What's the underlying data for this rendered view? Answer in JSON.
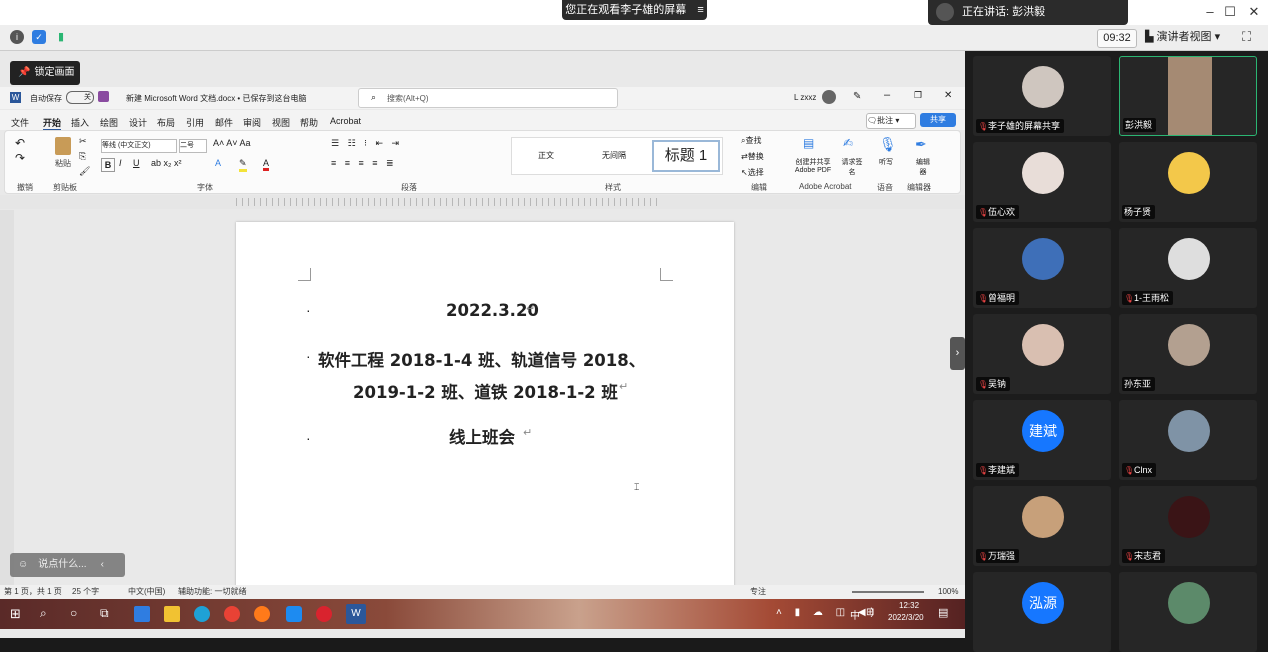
{
  "meeting": {
    "viewing_banner": "您正在观看李子雄的屏幕",
    "speaking_label": "正在讲话: 彭洪毅",
    "window_controls": [
      "–",
      "☐",
      "✕"
    ],
    "timer": "09:32",
    "presenter_view": "演讲者视图",
    "lock_screen": "锁定画面",
    "chat_placeholder": "说点什么..."
  },
  "word": {
    "autosave": "自动保存",
    "autosave_state": "关",
    "doc_title": "新建 Microsoft Word 文档.docx • 已保存到这台电脑",
    "search_placeholder": "搜索(Alt+Q)",
    "user": "L zxxz",
    "menu": [
      "文件",
      "开始",
      "插入",
      "绘图",
      "设计",
      "布局",
      "引用",
      "邮件",
      "审阅",
      "视图",
      "帮助",
      "Acrobat"
    ],
    "active_menu": "开始",
    "comment_btn": "批注",
    "share_btn": "共享",
    "ribbon": {
      "undo": "撤销",
      "clipboard": "剪贴板",
      "paste": "粘贴",
      "font_group": "字体",
      "font_name": "等线 (中文正文)",
      "font_size": "二号",
      "paragraph": "段落",
      "styles": "样式",
      "style_items": [
        "正文",
        "无间隔",
        "标题 1"
      ],
      "editing": "编辑",
      "find": "查找",
      "replace": "替换",
      "select": "选择",
      "adobe": "Adobe Acrobat",
      "adobe_btn": "创建并共享 Adobe PDF",
      "sign": "请求签名",
      "voice": "语音",
      "dictate": "听写",
      "editor": "编辑器",
      "editor_group": "编辑器"
    },
    "doc_lines": [
      "2022.3.20",
      "软件工程 2018-1-4 班、轨道信号 2018、",
      "2019-1-2 班、道铁 2018-1-2 班",
      "线上班会"
    ],
    "status": {
      "page": "第 1 页，共 1 页",
      "words": "25 个字",
      "lang": "中文(中国)",
      "accessibility": "辅助功能: 一切就绪",
      "focus": "专注",
      "zoom": "100%"
    },
    "taskbar_time": "12:32",
    "taskbar_date": "2022/3/20",
    "taskbar_ime": "中"
  },
  "participants": [
    {
      "name": "李子雄的屏幕共享",
      "avatar_text": "",
      "color": "#cfc6bf",
      "muted": true,
      "active": false
    },
    {
      "name": "彭洪毅",
      "avatar_text": "",
      "color": "#a58a73",
      "muted": false,
      "active": true
    },
    {
      "name": "伍心欢",
      "avatar_text": "",
      "color": "#e8ddd8",
      "muted": true,
      "active": false
    },
    {
      "name": "杨子贤",
      "avatar_text": "",
      "color": "#f3c84a",
      "muted": false,
      "active": false
    },
    {
      "name": "曾福明",
      "avatar_text": "",
      "color": "#3e6fb8",
      "muted": true,
      "active": false
    },
    {
      "name": "1-王雨松",
      "avatar_text": "",
      "color": "#dedede",
      "muted": true,
      "active": false
    },
    {
      "name": "吴钠",
      "avatar_text": "",
      "color": "#d9bfb1",
      "muted": true,
      "active": false
    },
    {
      "name": "孙东亚",
      "avatar_text": "",
      "color": "#b3a090",
      "muted": false,
      "active": false
    },
    {
      "name": "李建斌",
      "avatar_text": "建斌",
      "color": "#1677ff",
      "muted": true,
      "active": false
    },
    {
      "name": "Clnx",
      "avatar_text": "",
      "color": "#7f93a6",
      "muted": true,
      "active": false
    },
    {
      "name": "万瑞强",
      "avatar_text": "",
      "color": "#c7a07a",
      "muted": true,
      "active": false
    },
    {
      "name": "宋志君",
      "avatar_text": "",
      "color": "#3a1416",
      "muted": true,
      "active": false
    },
    {
      "name": "",
      "avatar_text": "泓源",
      "color": "#1677ff",
      "muted": false,
      "active": false
    },
    {
      "name": "",
      "avatar_text": "",
      "color": "#5c8a6a",
      "muted": false,
      "active": false
    }
  ]
}
